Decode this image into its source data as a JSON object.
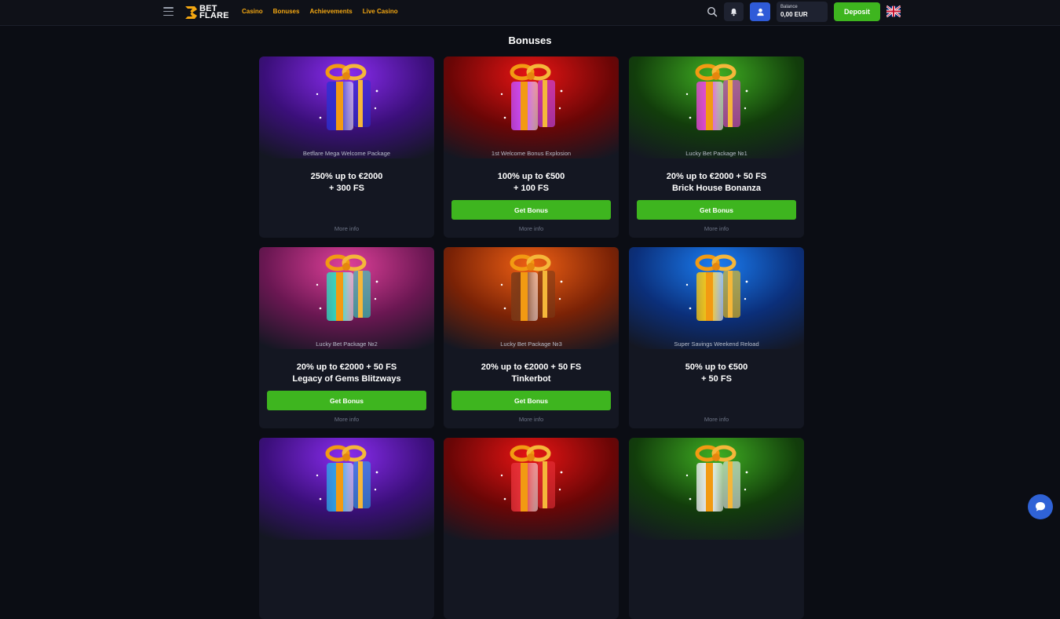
{
  "header": {
    "logo_line1": "BET",
    "logo_line2": "FLARE",
    "nav": [
      "Casino",
      "Bonuses",
      "Achievements",
      "Live Casino"
    ],
    "balance_label": "Balance",
    "balance_value": "0,00 EUR",
    "deposit_label": "Deposit",
    "accent_color": "#f3a712",
    "green_color": "#3eb51f"
  },
  "page_title": "Bonuses",
  "cards": [
    {
      "name": "Betflare Mega Welcome Package",
      "offer_line1": "250% up to €2000",
      "offer_line2": "+ 300 FS",
      "button": "",
      "more": "More info",
      "theme": "purple",
      "box_color": "#2d2fd1"
    },
    {
      "name": "1st Welcome Bonus Explosion",
      "offer_line1": "100% up to €500",
      "offer_line2": "+ 100 FS",
      "button": "Get Bonus",
      "more": "More info",
      "theme": "red",
      "box_color": "#c94dff"
    },
    {
      "name": "Lucky Bet Package №1",
      "offer_line1": "20% up to €2000 + 50 FS",
      "offer_line2": "Brick House Bonanza",
      "button": "Get Bonus",
      "more": "More info",
      "theme": "green",
      "box_color": "#ee48e0"
    },
    {
      "name": "Lucky Bet Package №2",
      "offer_line1": "20% up to €2000 + 50 FS",
      "offer_line2": "Legacy of Gems Blitzways",
      "button": "Get Bonus",
      "more": "More info",
      "theme": "pink",
      "box_color": "#2ee0c1"
    },
    {
      "name": "Lucky Bet Package №3",
      "offer_line1": "20% up to €2000 + 50 FS",
      "offer_line2": "Tinkerbot",
      "button": "Get Bonus",
      "more": "More info",
      "theme": "orange",
      "box_color": "#7a3a18"
    },
    {
      "name": "Super Savings Weekend Reload",
      "offer_line1": "50% up to €500",
      "offer_line2": "+ 50 FS",
      "button": "",
      "more": "More info",
      "theme": "blue",
      "box_color": "#ffcc12"
    },
    {
      "name": "",
      "offer_line1": "",
      "offer_line2": "",
      "button": "",
      "more": "",
      "theme": "purple",
      "box_color": "#2ea9e8"
    },
    {
      "name": "",
      "offer_line1": "",
      "offer_line2": "",
      "button": "",
      "more": "",
      "theme": "red",
      "box_color": "#e8323a"
    },
    {
      "name": "",
      "offer_line1": "",
      "offer_line2": "",
      "button": "",
      "more": "",
      "theme": "green",
      "box_color": "#f1f1f6"
    }
  ]
}
